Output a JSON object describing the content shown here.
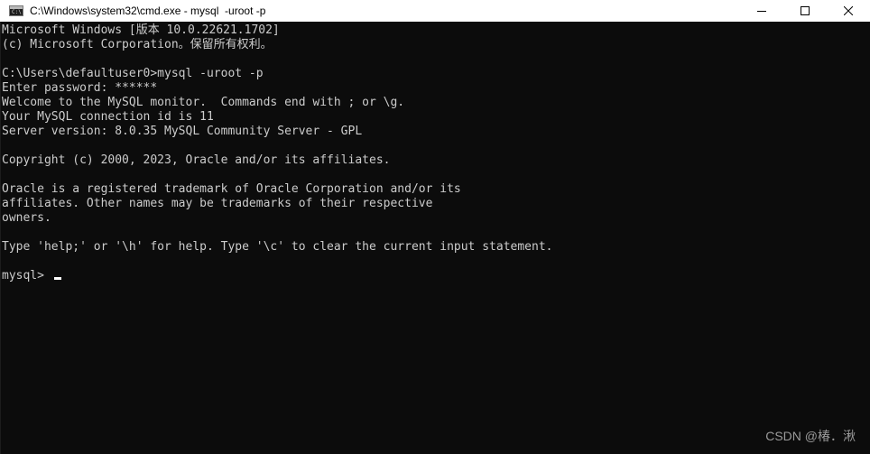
{
  "window": {
    "title": "C:\\Windows\\system32\\cmd.exe - mysql  -uroot -p",
    "icon": "cmd-icon",
    "icon_glyph": "C:\\"
  },
  "controls": {
    "minimize_icon": "minimize-icon",
    "maximize_icon": "maximize-icon",
    "close_icon": "close-icon"
  },
  "terminal": {
    "lines": [
      "Microsoft Windows [版本 10.0.22621.1702]",
      "(c) Microsoft Corporation。保留所有权利。",
      "",
      "C:\\Users\\defaultuser0>mysql -uroot -p",
      "Enter password: ******",
      "Welcome to the MySQL monitor.  Commands end with ; or \\g.",
      "Your MySQL connection id is 11",
      "Server version: 8.0.35 MySQL Community Server - GPL",
      "",
      "Copyright (c) 2000, 2023, Oracle and/or its affiliates.",
      "",
      "Oracle is a registered trademark of Oracle Corporation and/or its",
      "affiliates. Other names may be trademarks of their respective",
      "owners.",
      "",
      "Type 'help;' or '\\h' for help. Type '\\c' to clear the current input statement.",
      ""
    ],
    "prompt": "mysql> ",
    "background": "#0c0c0c",
    "foreground": "#cccccc"
  },
  "watermark": "CSDN @椿．湫"
}
